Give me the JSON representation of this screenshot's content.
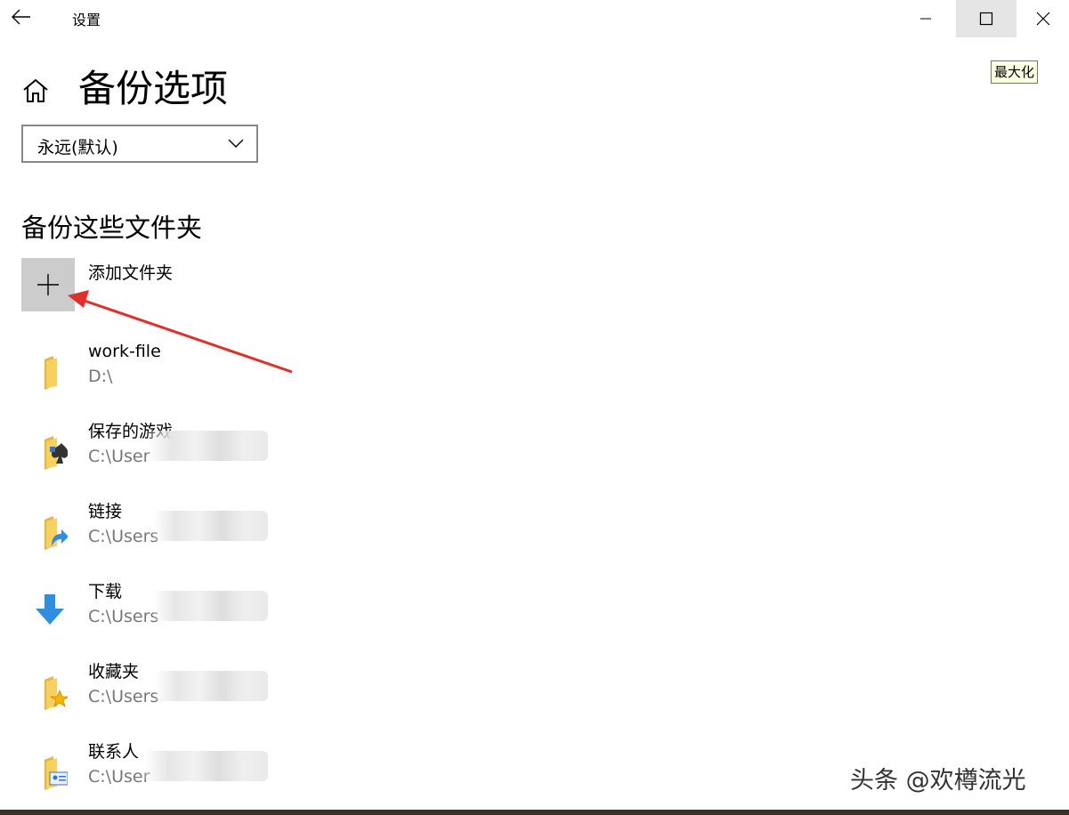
{
  "window": {
    "title": "设置",
    "tooltip": "最大化"
  },
  "page": {
    "title": "备份选项"
  },
  "retention": {
    "selected": "永远(默认)"
  },
  "section": {
    "title": "备份这些文件夹",
    "add_label": "添加文件夹"
  },
  "folders": [
    {
      "name": "work-file",
      "path": "D:\\",
      "icon": "folder-icon"
    },
    {
      "name": "保存的游戏",
      "path": "C:\\User",
      "icon": "saved-games-folder-icon"
    },
    {
      "name": "链接",
      "path": "C:\\Users",
      "icon": "links-folder-icon"
    },
    {
      "name": "下载",
      "path": "C:\\Users",
      "icon": "download-arrow-icon"
    },
    {
      "name": "收藏夹",
      "path": "C:\\Users",
      "icon": "favorites-folder-icon"
    },
    {
      "name": "联系人",
      "path": "C:\\User",
      "icon": "contacts-folder-icon"
    }
  ],
  "watermark": "头条 @欢樽流光",
  "colors": {
    "accent_arrow": "#e0302a",
    "folder_yellow": "#f3c646",
    "download_blue": "#2f8ee0"
  }
}
